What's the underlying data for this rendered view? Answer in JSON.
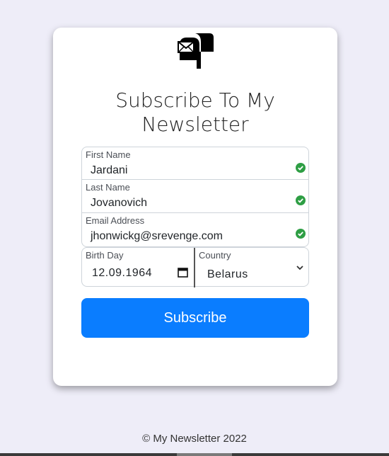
{
  "card": {
    "logo_icon": "mailbox-icon",
    "title_line1": "Subscribe To My",
    "title_line2": "Newsletter"
  },
  "form": {
    "first_name": {
      "label": "First Name",
      "value": "Jardani",
      "status_icon": "check-circle-icon"
    },
    "last_name": {
      "label": "Last Name",
      "value": "Jovanovich",
      "status_icon": "check-circle-icon"
    },
    "email": {
      "label": "Email Address",
      "value": "jhonwickg@srevenge.com",
      "status_icon": "check-circle-icon"
    },
    "birth_day": {
      "label": "Birth Day",
      "value": "12.09.1964",
      "icon": "calendar-icon"
    },
    "country": {
      "label": "Country",
      "value": "Belarus",
      "icon": "chevron-down-icon"
    },
    "submit_label": "Subscribe"
  },
  "footer": {
    "text": "© My Newsletter 2022"
  },
  "colors": {
    "background": "#eeedf8",
    "button": "#0a7dff",
    "valid": "#2e9e44"
  }
}
